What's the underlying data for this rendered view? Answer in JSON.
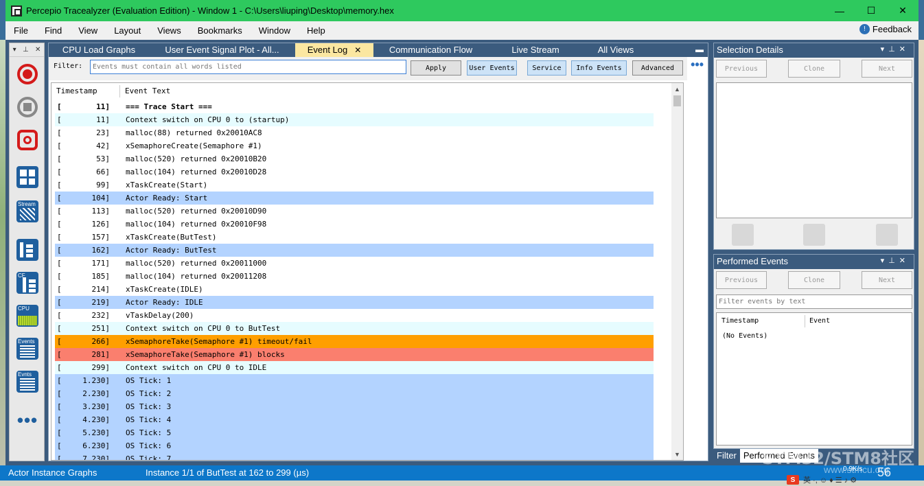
{
  "window": {
    "title": "Percepio Tracealyzer (Evaluation Edition) - Window 1 - C:\\Users\\liuping\\Desktop\\memory.hex",
    "controls": [
      "—",
      "☐",
      "✕"
    ]
  },
  "menu": {
    "items": [
      "File",
      "Find",
      "View",
      "Layout",
      "Views",
      "Bookmarks",
      "Window",
      "Help"
    ],
    "feedback": "Feedback"
  },
  "left_toolbar": {
    "tiles": {
      "stream": "Stream",
      "cf": "CF",
      "cpu": "CPU",
      "events": "Events",
      "evnts": "Evnts"
    }
  },
  "tabs": [
    {
      "label": "CPU Load Graphs"
    },
    {
      "label": "User Event Signal Plot - All..."
    },
    {
      "label": "Event Log",
      "active": true
    },
    {
      "label": "Communication Flow"
    },
    {
      "label": "Live Stream"
    },
    {
      "label": "All Views"
    }
  ],
  "filter": {
    "label": "Filter:",
    "placeholder": "Events must contain all words listed",
    "buttons": [
      "Apply",
      "User Events",
      "Service",
      "Info Events",
      "Advanced"
    ]
  },
  "event_log": {
    "columns": {
      "timestamp": "Timestamp",
      "event_text": "Event Text"
    },
    "rows": [
      {
        "ts": "11]",
        "text": "=== Trace Start ===",
        "style": "bold"
      },
      {
        "ts": "11]",
        "text": "Context switch on CPU 0 to (startup)",
        "style": "ctx"
      },
      {
        "ts": "23]",
        "text": "malloc(88) returned 0x20010AC8",
        "style": ""
      },
      {
        "ts": "42]",
        "text": "xSemaphoreCreate(Semaphore #1)",
        "style": ""
      },
      {
        "ts": "53]",
        "text": "malloc(520) returned 0x20010B20",
        "style": ""
      },
      {
        "ts": "66]",
        "text": "malloc(104) returned 0x20010D28",
        "style": ""
      },
      {
        "ts": "99]",
        "text": "xTaskCreate(Start)",
        "style": ""
      },
      {
        "ts": "104]",
        "text": "Actor Ready: Start",
        "style": "ready"
      },
      {
        "ts": "113]",
        "text": "malloc(520) returned 0x20010D90",
        "style": ""
      },
      {
        "ts": "126]",
        "text": "malloc(104) returned 0x20010F98",
        "style": ""
      },
      {
        "ts": "157]",
        "text": "xTaskCreate(ButTest)",
        "style": ""
      },
      {
        "ts": "162]",
        "text": "Actor Ready: ButTest",
        "style": "ready"
      },
      {
        "ts": "171]",
        "text": "malloc(520) returned 0x20011000",
        "style": ""
      },
      {
        "ts": "185]",
        "text": "malloc(104) returned 0x20011208",
        "style": ""
      },
      {
        "ts": "214]",
        "text": "xTaskCreate(IDLE)",
        "style": ""
      },
      {
        "ts": "219]",
        "text": "Actor Ready: IDLE",
        "style": "ready"
      },
      {
        "ts": "232]",
        "text": "vTaskDelay(200)",
        "style": ""
      },
      {
        "ts": "251]",
        "text": "Context switch on CPU 0 to ButTest",
        "style": "ctx"
      },
      {
        "ts": "266]",
        "text": "xSemaphoreTake(Semaphore #1) timeout/fail",
        "style": "warn"
      },
      {
        "ts": "281]",
        "text": "xSemaphoreTake(Semaphore #1) blocks",
        "style": "err"
      },
      {
        "ts": "299]",
        "text": "Context switch on CPU 0 to IDLE",
        "style": "ctx"
      },
      {
        "ts": "1.230]",
        "text": "OS Tick: 1",
        "style": "tick"
      },
      {
        "ts": "2.230]",
        "text": "OS Tick: 2",
        "style": "tick"
      },
      {
        "ts": "3.230]",
        "text": "OS Tick: 3",
        "style": "tick"
      },
      {
        "ts": "4.230]",
        "text": "OS Tick: 4",
        "style": "tick"
      },
      {
        "ts": "5.230]",
        "text": "OS Tick: 5",
        "style": "tick"
      },
      {
        "ts": "6.230]",
        "text": "OS Tick: 6",
        "style": "tick"
      },
      {
        "ts": "7.230]",
        "text": "OS Tick: 7",
        "style": "tick"
      }
    ]
  },
  "selection_details": {
    "title": "Selection Details",
    "buttons": [
      "Previous",
      "Clone",
      "Next"
    ]
  },
  "performed_events": {
    "title": "Performed Events",
    "buttons": [
      "Previous",
      "Clone",
      "Next"
    ],
    "filter_placeholder": "Filter events by text",
    "columns": {
      "timestamp": "Timestamp",
      "event": "Event"
    },
    "empty": "(No Events)"
  },
  "bottom_tabs": [
    {
      "label": "Filter"
    },
    {
      "label": "Performed Events",
      "active": true
    }
  ],
  "statusbar": {
    "view": "Actor Instance Graphs",
    "info": "Instance 1/1 of ButTest at 162 to 299 (µs)",
    "speed": "0.9K/s",
    "big": "56"
  },
  "watermark": {
    "text": "STM32/STM8社区",
    "sub": "www.stmcu.org"
  },
  "ime": {
    "logo": "S",
    "text": "英 ·, ☺ ♦ ☰ ♪ ⚙"
  }
}
